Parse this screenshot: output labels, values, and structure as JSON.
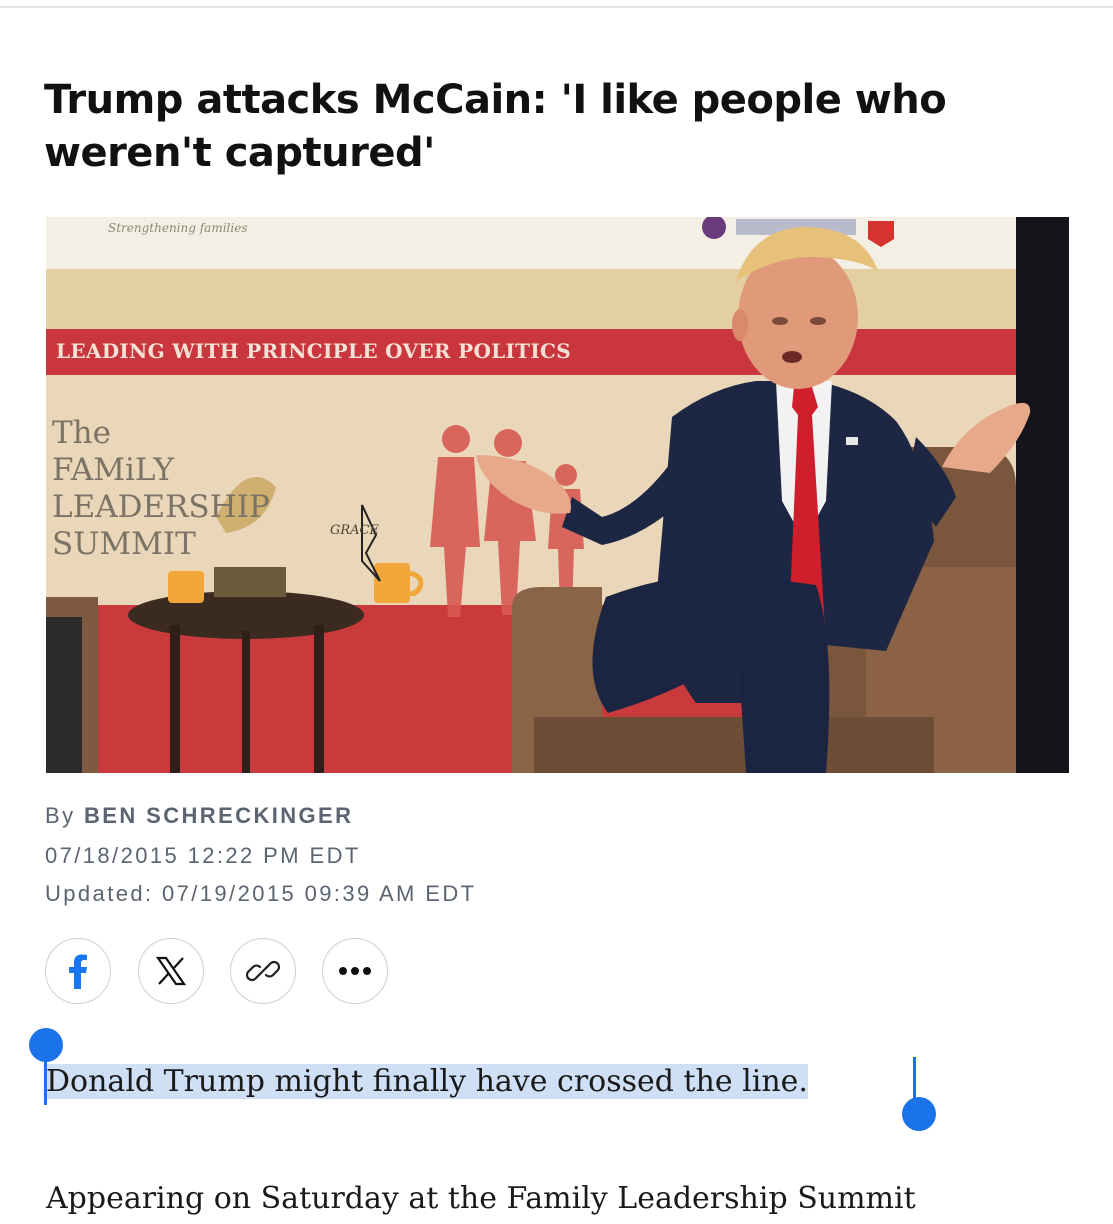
{
  "article": {
    "headline": "Trump attacks McCain: 'I like people who weren't captured'",
    "photo": {
      "banner_text": "LEADING WITH PRINCIPLE OVER POLITICS",
      "top_text": "Strengthening families",
      "summit_text": "The\nFAMiLY\nLEADERSHIP\nSUMMIT",
      "grace_text": "GRACE"
    },
    "byline_prefix": "By",
    "author": "BEN SCHRECKINGER",
    "published": "07/18/2015 12:22 PM EDT",
    "updated": "Updated: 07/19/2015 09:39 AM EDT",
    "first_paragraph": "Donald Trump might finally have crossed the line.",
    "second_paragraph": "Appearing on Saturday at the Family Leadership Summit"
  },
  "share": {
    "buttons": [
      {
        "icon": "facebook-icon"
      },
      {
        "icon": "x-icon"
      },
      {
        "icon": "link-icon"
      },
      {
        "icon": "more-icon"
      }
    ]
  },
  "colors": {
    "selection": "#cfe0f6",
    "selection_handle": "#1a73e8",
    "byline_text": "#5b6470",
    "facebook_blue": "#1877f2"
  }
}
